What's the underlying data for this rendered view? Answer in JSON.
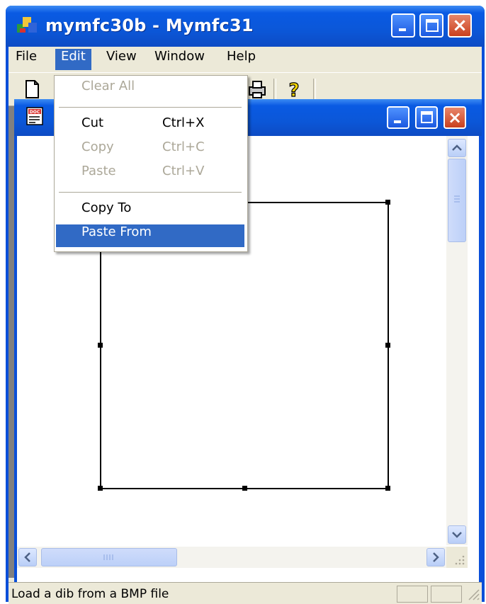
{
  "window": {
    "title": "mymfc30b - Mymfc31"
  },
  "menubar": {
    "items": [
      "File",
      "Edit",
      "View",
      "Window",
      "Help"
    ],
    "open_menu": "Edit"
  },
  "edit_menu": {
    "clear_all": "Clear All",
    "cut": "Cut",
    "cut_accel": "Ctrl+X",
    "copy": "Copy",
    "copy_accel": "Ctrl+C",
    "paste": "Paste",
    "paste_accel": "Ctrl+V",
    "copy_to": "Copy To",
    "paste_from": "Paste From"
  },
  "statusbar": {
    "text": "Load a dib from a BMP file"
  },
  "toolbar": {
    "buttons": [
      "new-file-icon",
      "print-icon",
      "help-icon"
    ]
  },
  "colors": {
    "title_blue": "#0a5ae3",
    "menu_highlight": "#316ac5",
    "face": "#ece9d8",
    "close_red": "#c9401e"
  }
}
